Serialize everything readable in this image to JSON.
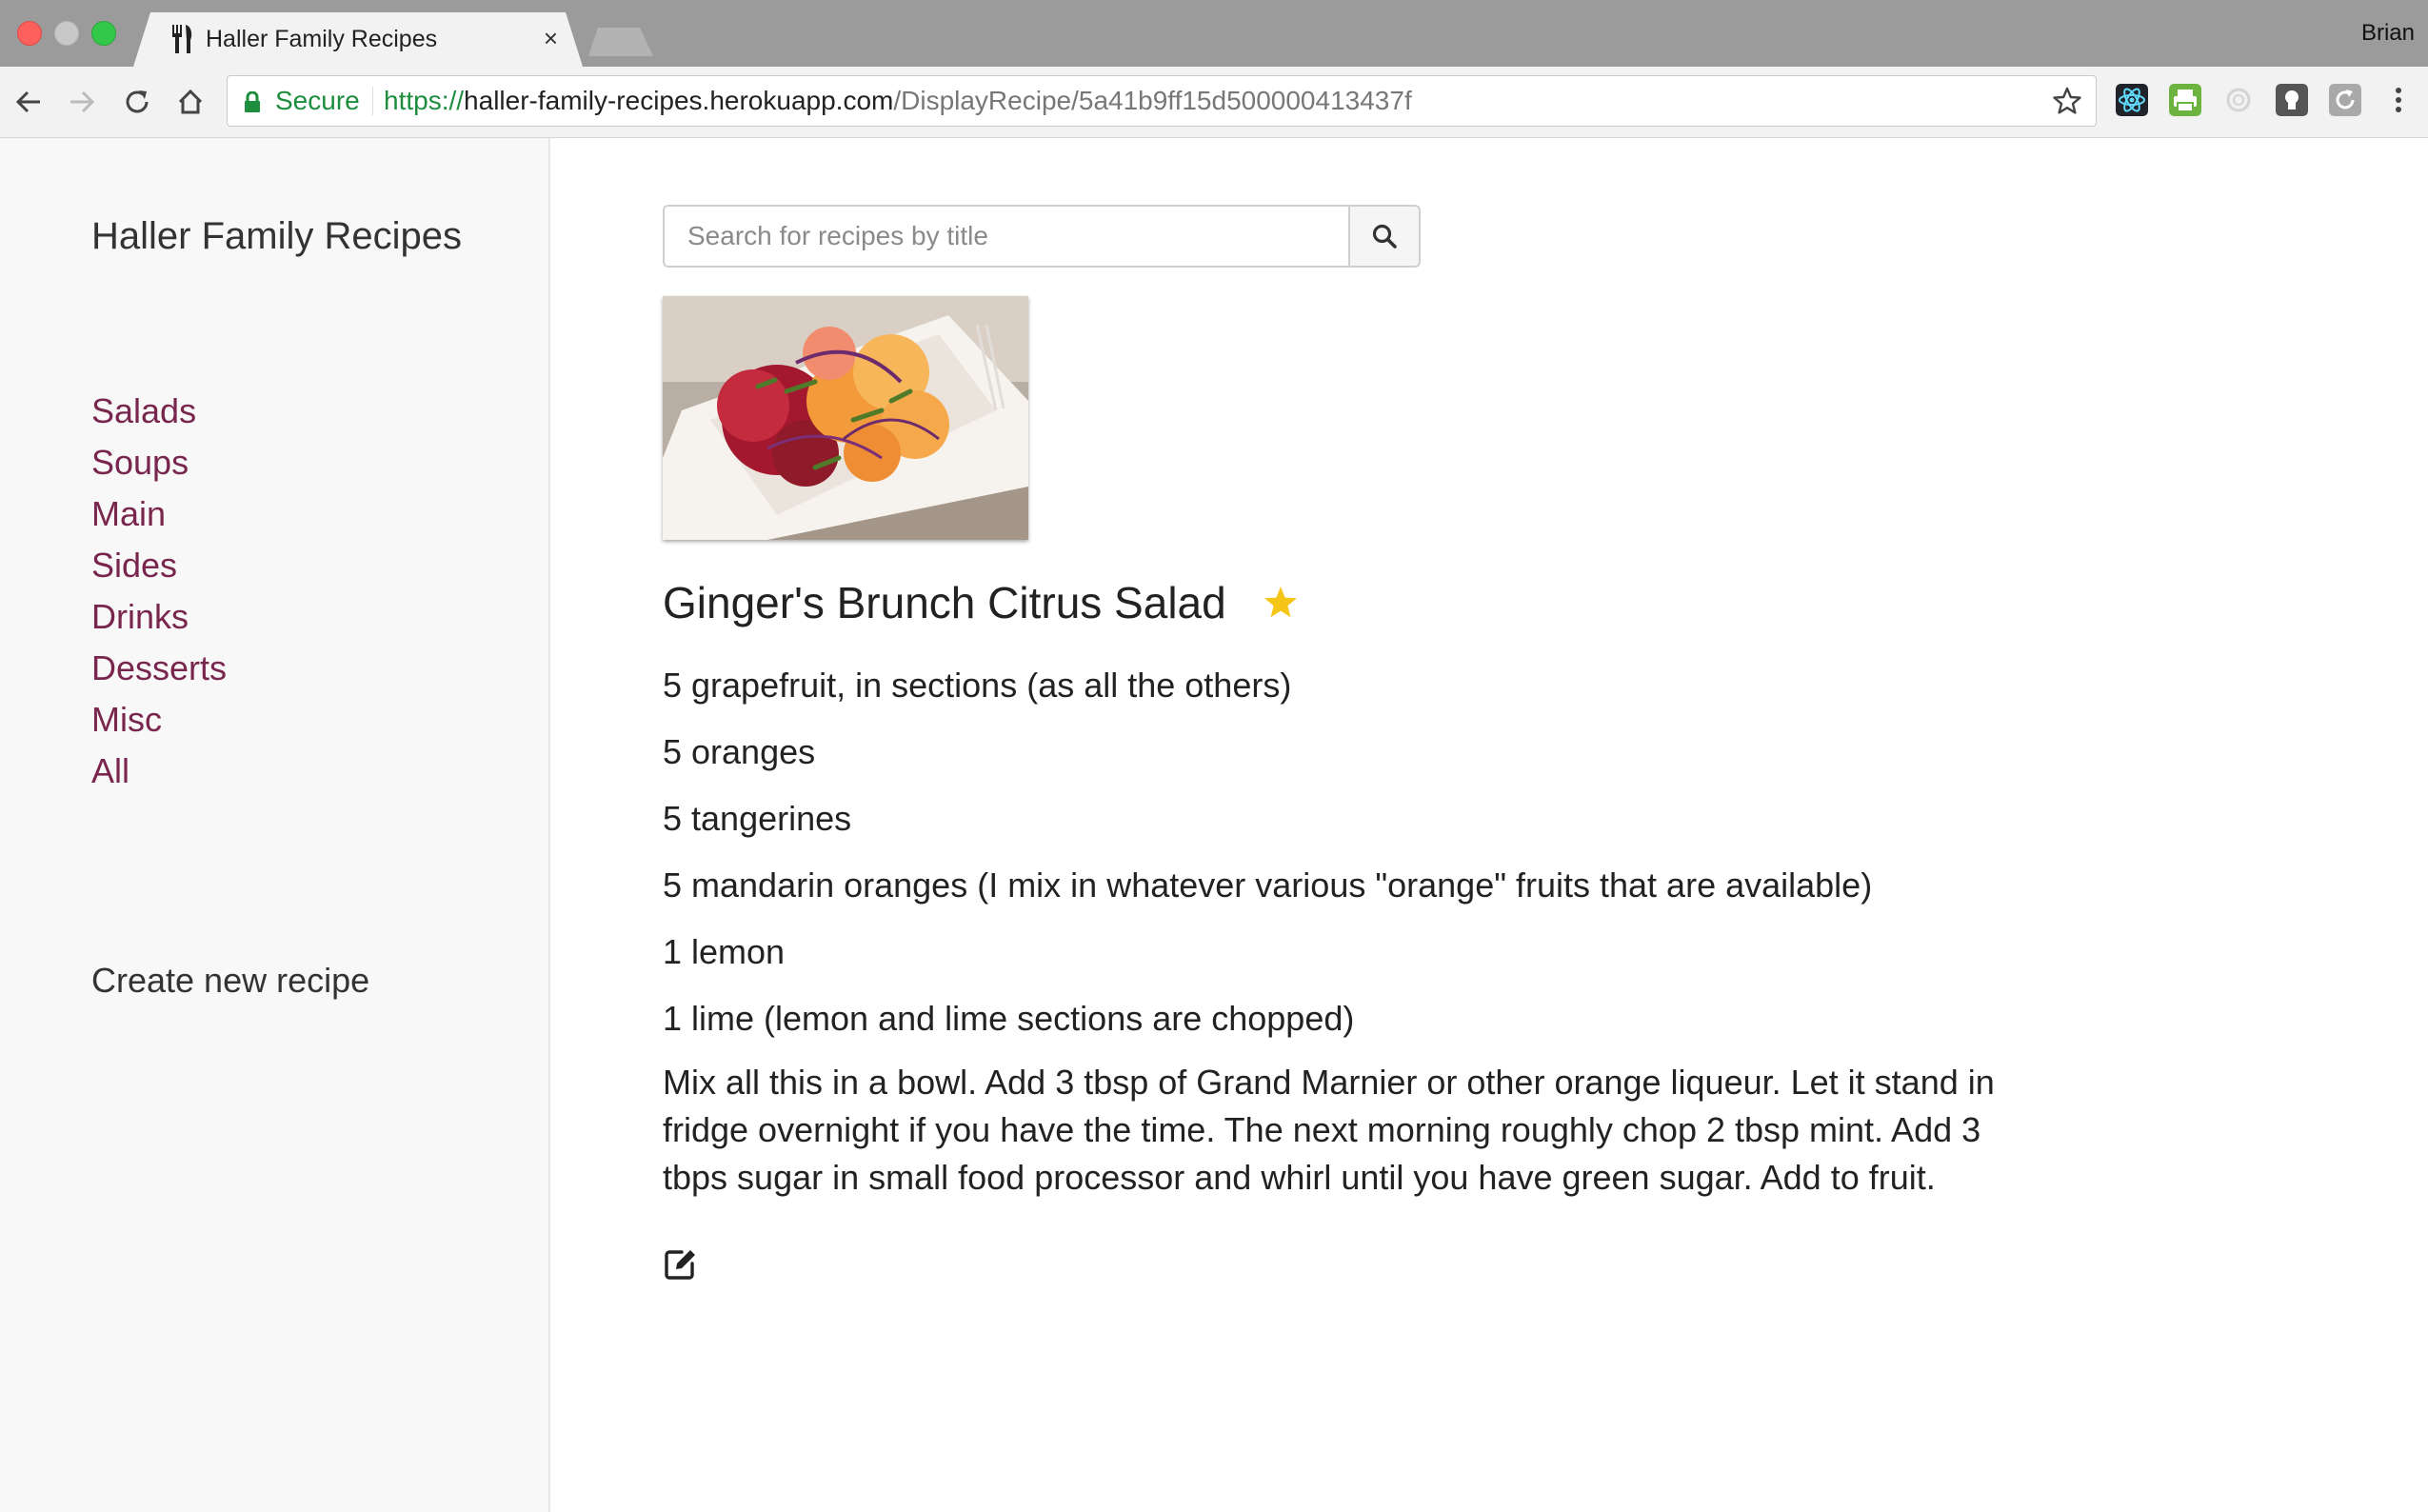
{
  "browser": {
    "tab_title": "Haller Family Recipes",
    "tab_close": "×",
    "profile_name": "Brian",
    "secure_label": "Secure",
    "url_scheme": "https://",
    "url_host": "haller-family-recipes.herokuapp.com",
    "url_path": "/DisplayRecipe/5a41b9ff15d500000413437f",
    "icons": [
      "back-arrow-icon",
      "forward-arrow-icon",
      "reload-icon",
      "home-icon",
      "lock-icon",
      "bookmark-star-icon",
      "react-devtools-icon",
      "print-extension-icon",
      "disabled-extension-icon",
      "lightbulb-extension-icon",
      "sync-extension-icon",
      "kebab-menu-icon"
    ]
  },
  "sidebar": {
    "brand": "Haller Family Recipes",
    "categories": [
      "Salads",
      "Soups",
      "Main",
      "Sides",
      "Drinks",
      "Desserts",
      "Misc",
      "All"
    ],
    "create_link": "Create new recipe"
  },
  "search": {
    "placeholder": "Search for recipes by title",
    "icon": "search-icon"
  },
  "recipe": {
    "title": "Ginger's Brunch Citrus Salad",
    "favorite": true,
    "ingredients": [
      "5 grapefruit, in sections (as all the others)",
      "5 oranges",
      "5 tangerines",
      "5 mandarin oranges (I mix in whatever various \"orange\" fruits that are available)",
      "1 lemon",
      "1 lime (lemon and lime sections are chopped)"
    ],
    "directions": "Mix all this in a bowl. Add 3 tbsp of Grand Marnier or other orange liqueur. Let it stand in fridge overnight if you have the time. The next morning roughly chop 2 tbsp mint. Add 3 tbps sugar in small food processor and whirl until you have green sugar. Add to fruit.",
    "edit_icon": "edit-icon"
  },
  "colors": {
    "category_link": "#78264e",
    "secure_green": "#1e8e3e",
    "favorite_star": "#f5c518"
  }
}
